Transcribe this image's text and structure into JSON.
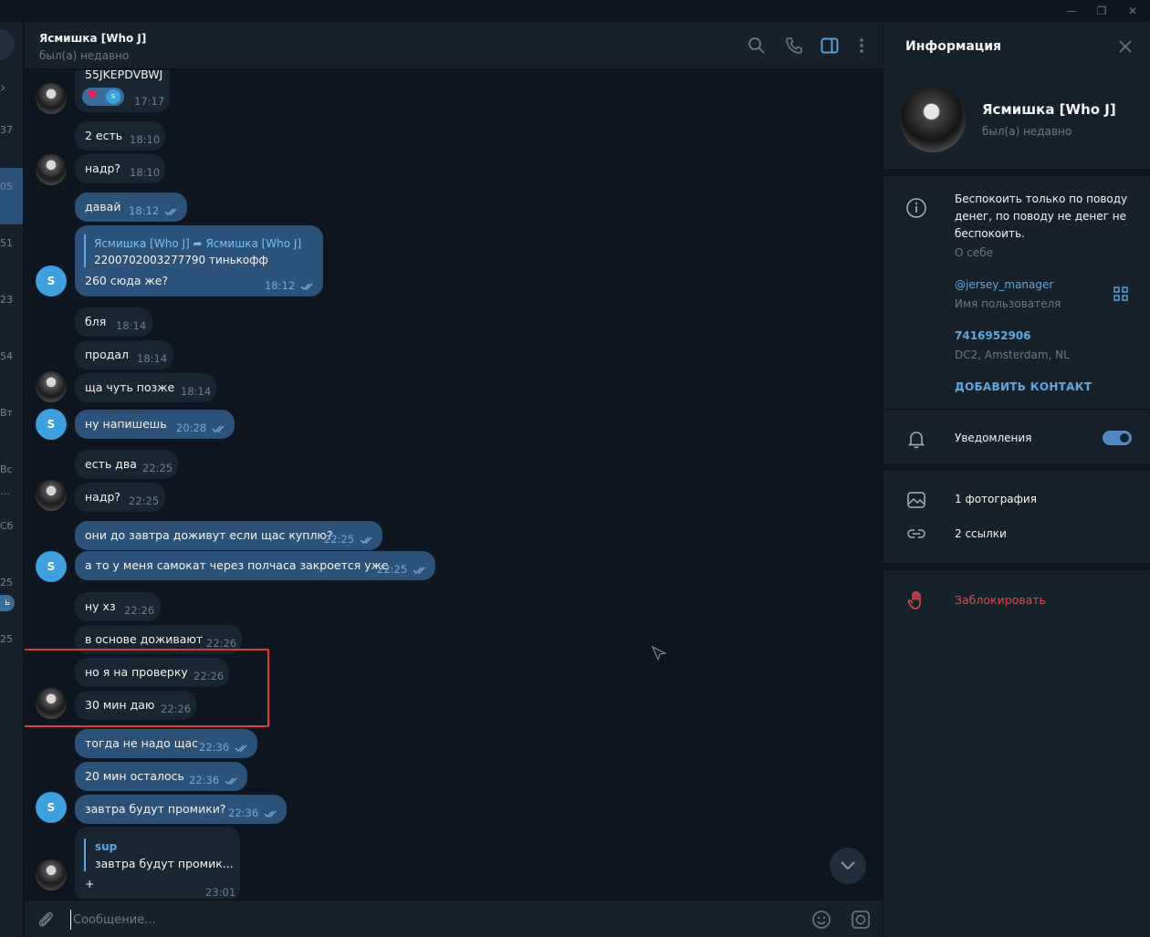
{
  "window": {
    "controls": [
      "—",
      "❐",
      "✕"
    ]
  },
  "sidebar": {
    "times": [
      "37",
      "05",
      "51",
      "23",
      "54",
      "Вт",
      "Вс",
      "…",
      "Сб",
      "25",
      "25"
    ],
    "badge": "ь"
  },
  "header": {
    "name": "Ясмишка [Who J]",
    "status": "был(а) недавно"
  },
  "messages": [
    {
      "text": "55JKEPDVBWJ",
      "time": "17:17",
      "out": false,
      "reaction": "s"
    },
    {
      "text": "2 есть",
      "time": "18:10",
      "out": false
    },
    {
      "text": "надр?",
      "time": "18:10",
      "out": false
    },
    {
      "text": "давай",
      "time": "18:12",
      "out": true
    },
    {
      "forward_from": "Ясмишка [Who J]",
      "forward_to": "Ясмишка [Who J]",
      "quote": "2200702003277790 тинькофф",
      "text": "260 сюда же?",
      "time": "18:12",
      "out": true
    },
    {
      "text": "бля",
      "time": "18:14",
      "out": false
    },
    {
      "text": "продал",
      "time": "18:14",
      "out": false
    },
    {
      "text": "ща чуть позже",
      "time": "18:14",
      "out": false
    },
    {
      "text": "ну напишешь",
      "time": "20:28",
      "out": true
    },
    {
      "text": "есть два",
      "time": "22:25",
      "out": false
    },
    {
      "text": "надр?",
      "time": "22:25",
      "out": false
    },
    {
      "text": "они до завтра доживут если щас куплю?",
      "time": "22:25",
      "out": true
    },
    {
      "text": "а то у меня самокат через полчаса закроется уже",
      "time": "22:25",
      "out": true
    },
    {
      "text": "ну хз",
      "time": "22:26",
      "out": false
    },
    {
      "text": "в основе доживают",
      "time": "22:26",
      "out": false
    },
    {
      "text": "но я на проверку",
      "time": "22:26",
      "out": false
    },
    {
      "text": "30 мин даю",
      "time": "22:26",
      "out": false
    },
    {
      "text": "тогда не надо щас",
      "time": "22:36",
      "out": true
    },
    {
      "text": "20 мин осталось",
      "time": "22:36",
      "out": true
    },
    {
      "text": "завтра будут промики?",
      "time": "22:36",
      "out": true
    },
    {
      "reply_name": "sup",
      "reply_text": "завтра будут промик...",
      "text": "+",
      "time": "23:01",
      "out": false
    }
  ],
  "avatar_letter": "S",
  "composer": {
    "placeholder": "Сообщение..."
  },
  "info": {
    "title": "Информация",
    "name": "Ясмишка [Who J]",
    "status": "был(а) недавно",
    "bio": "Беспокоить только по поводу денег, по поводу не денег не беспокоить.",
    "bio_label": "О себе",
    "username": "@jersey_manager",
    "username_label": "Имя пользователя",
    "id": "7416952906",
    "dc": "DC2, Amsterdam, NL",
    "add_contact": "ДОБАВИТЬ КОНТАКТ",
    "notifications": "Уведомления",
    "notifications_on": true,
    "photos": "1 фотография",
    "links": "2 ссылки",
    "block": "Заблокировать"
  },
  "colors": {
    "background": "#0e1621",
    "panel": "#17212b",
    "incoming": "#182533",
    "outgoing": "#2b5278",
    "accent": "#5ea9e5",
    "danger": "#e5484d",
    "highlight": "#e53935"
  }
}
